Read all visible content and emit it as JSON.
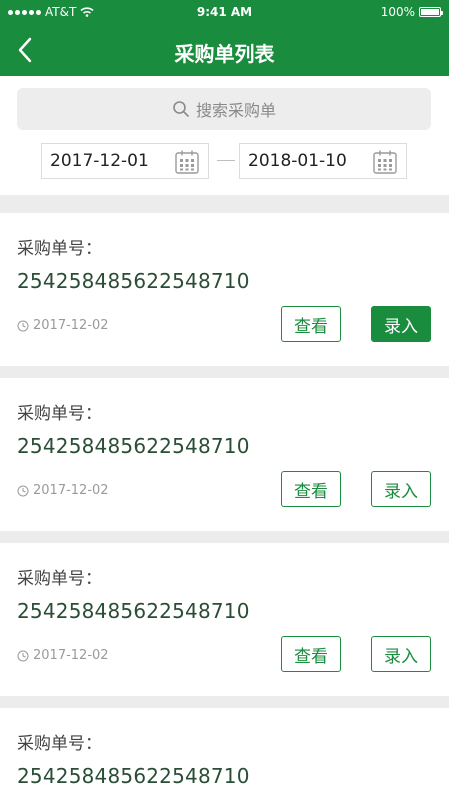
{
  "status": {
    "carrier": "AT&T",
    "time": "9:41 AM",
    "battery": "100%"
  },
  "header": {
    "title": "采购单列表"
  },
  "search": {
    "placeholder": "搜索采购单"
  },
  "dates": {
    "from": "2017-12-01",
    "to": "2018-01-10"
  },
  "colors": {
    "brand": "#1a8c3e",
    "text_number": "#2a4d35"
  },
  "orders": [
    {
      "label": "采购单号：",
      "number": "254258485622548710",
      "date": "2017-12-02",
      "view_label": "查看",
      "enter_label": "录入"
    },
    {
      "label": "采购单号：",
      "number": "254258485622548710",
      "date": "2017-12-02",
      "view_label": "查看",
      "enter_label": "录入"
    },
    {
      "label": "采购单号：",
      "number": "254258485622548710",
      "date": "2017-12-02",
      "view_label": "查看",
      "enter_label": "录入"
    },
    {
      "label": "采购单号：",
      "number": "254258485622548710"
    }
  ]
}
